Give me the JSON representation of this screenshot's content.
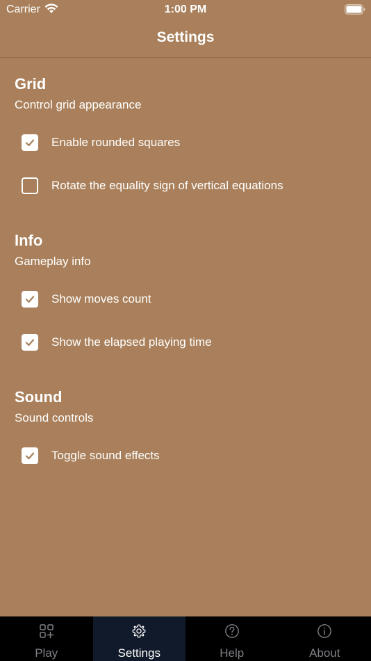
{
  "status_bar": {
    "carrier": "Carrier",
    "time": "1:00 PM"
  },
  "nav": {
    "title": "Settings"
  },
  "sections": [
    {
      "title": "Grid",
      "subtitle": "Control grid appearance",
      "options": [
        {
          "label": "Enable rounded squares",
          "checked": true
        },
        {
          "label": "Rotate the equality sign of vertical equations",
          "checked": false
        }
      ]
    },
    {
      "title": "Info",
      "subtitle": "Gameplay info",
      "options": [
        {
          "label": "Show moves count",
          "checked": true
        },
        {
          "label": "Show the elapsed playing time",
          "checked": true
        }
      ]
    },
    {
      "title": "Sound",
      "subtitle": "Sound controls",
      "options": [
        {
          "label": "Toggle sound effects",
          "checked": true
        }
      ]
    }
  ],
  "tabs": [
    {
      "label": "Play",
      "icon": "grid-plus-icon",
      "active": false
    },
    {
      "label": "Settings",
      "icon": "gear-icon",
      "active": true
    },
    {
      "label": "Help",
      "icon": "question-circle-icon",
      "active": false
    },
    {
      "label": "About",
      "icon": "info-circle-icon",
      "active": false
    }
  ],
  "colors": {
    "background": "#a9805b",
    "tab_bar": "#000000",
    "tab_active": "#111a2a"
  }
}
